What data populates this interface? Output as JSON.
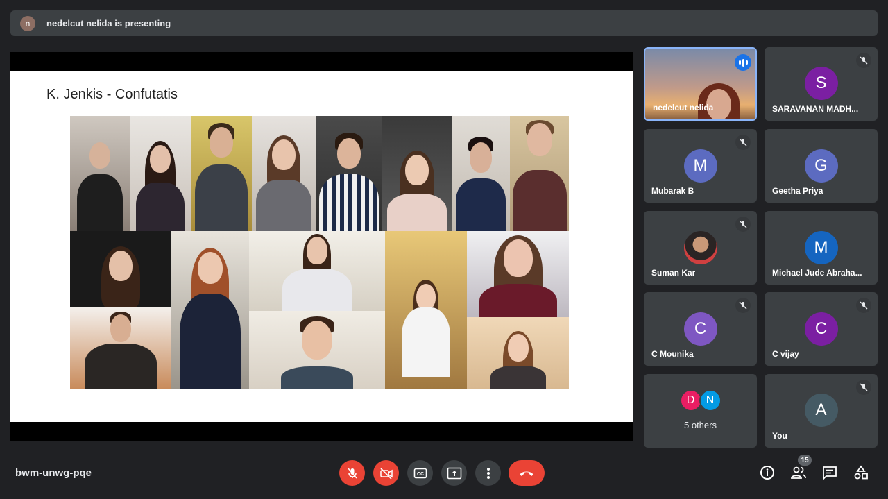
{
  "presenting_bar": {
    "avatar_letter": "n",
    "text": "nedelcut nelida is presenting"
  },
  "slide": {
    "title": "K. Jenkis - Confutatis"
  },
  "participants": [
    {
      "name": "nedelcut nelida",
      "type": "video",
      "speaking": true
    },
    {
      "name": "SARAVANAN MADH...",
      "letter": "S",
      "color": "#7b1fa2",
      "muted": true
    },
    {
      "name": "Mubarak B",
      "letter": "M",
      "color": "#5c6bc0",
      "muted": true
    },
    {
      "name": "Geetha Priya",
      "letter": "G",
      "color": "#5c6bc0",
      "muted": false
    },
    {
      "name": "Suman Kar",
      "type": "photo",
      "muted": true
    },
    {
      "name": "Michael Jude Abraha...",
      "letter": "M",
      "color": "#1565c0",
      "muted": false
    },
    {
      "name": "C Mounika",
      "letter": "C",
      "color": "#7e57c2",
      "muted": true
    },
    {
      "name": "C vijay",
      "letter": "C",
      "color": "#7b1fa2",
      "muted": true
    },
    {
      "name": "You",
      "letter": "A",
      "color": "#455a64",
      "muted": true
    }
  ],
  "others": {
    "label": "5 others",
    "avatars": [
      {
        "letter": "D",
        "color": "#e91e63"
      },
      {
        "letter": "N",
        "color": "#039be5"
      }
    ]
  },
  "toolbar": {
    "meeting_code": "bwm-unwg-pqe",
    "buttons": [
      "mic-off-icon",
      "camera-off-icon",
      "captions-icon",
      "present-icon",
      "more-icon",
      "hangup-icon"
    ],
    "participant_count": "15",
    "right_icons": [
      "info-icon",
      "people-icon",
      "chat-icon",
      "activities-icon"
    ]
  },
  "colors": {
    "background": "#202124",
    "tile": "#3c4043",
    "red": "#ea4335",
    "accent": "#8ab4f8"
  }
}
